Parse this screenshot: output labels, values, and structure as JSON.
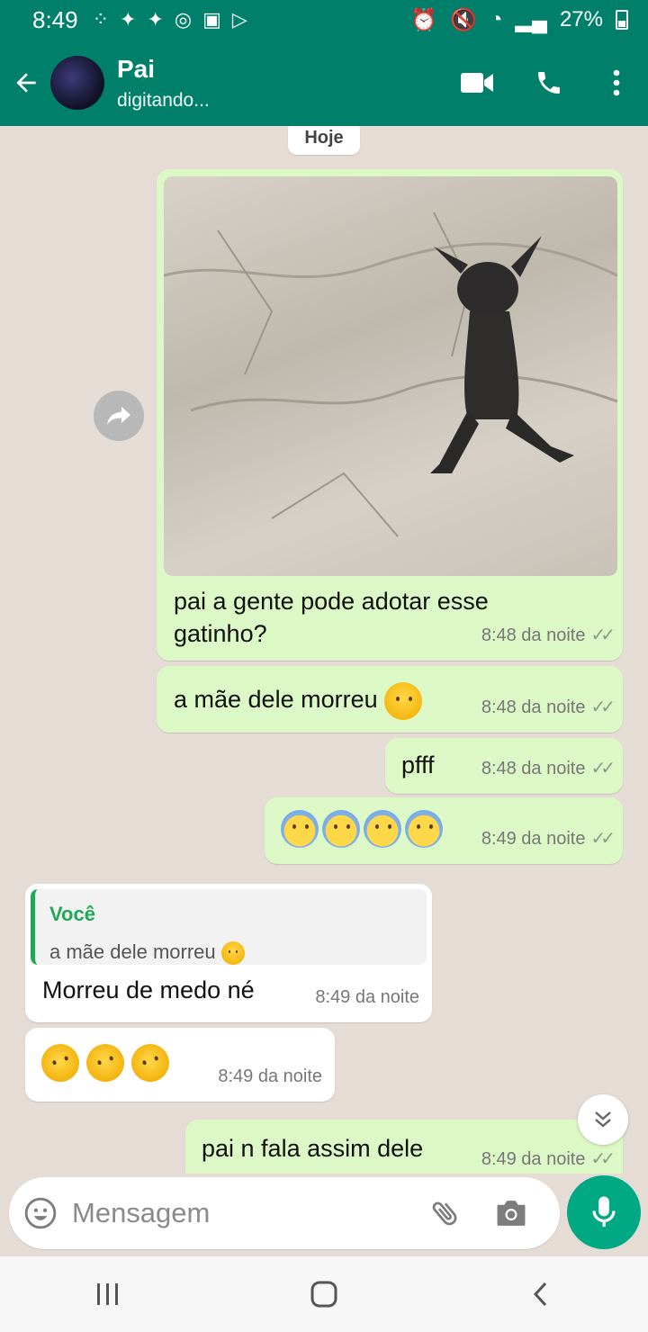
{
  "status_bar": {
    "time": "8:49",
    "battery": "27%"
  },
  "header": {
    "contact_name": "Pai",
    "contact_status": "digitando..."
  },
  "chat": {
    "date_divider": "Hoje",
    "messages": [
      {
        "dir": "out",
        "kind": "image",
        "caption_line1": "pai a gente pode adotar esse",
        "caption_line2": "gatinho?",
        "time": "8:48 da noite"
      },
      {
        "dir": "out",
        "text": "a mãe dele morreu",
        "time": "8:48 da noite"
      },
      {
        "dir": "out",
        "text": "pfff",
        "time": "8:48 da noite"
      },
      {
        "dir": "out",
        "kind": "emoji",
        "time": "8:49 da noite"
      },
      {
        "dir": "in",
        "reply_author": "Você",
        "reply_text": "a mãe dele morreu",
        "text": "Morreu de medo né",
        "time": "8:49 da noite"
      },
      {
        "dir": "in",
        "kind": "emoji",
        "time": "8:49 da noite"
      },
      {
        "dir": "out",
        "text": "pai n fala assim dele",
        "time": "8:49 da noite"
      }
    ]
  },
  "composer": {
    "placeholder": "Mensagem"
  },
  "icons": {
    "back": "arrow-left-icon",
    "video": "video-call-icon",
    "call": "phone-icon",
    "menu": "more-vert-icon",
    "forward": "forward-icon",
    "emoji": "emoji-icon",
    "attach": "paperclip-icon",
    "camera": "camera-icon",
    "mic": "mic-icon",
    "scroll": "chevron-double-down-icon",
    "nav_recents": "recents-icon",
    "nav_home": "home-icon",
    "nav_back": "nav-back-icon"
  },
  "colors": {
    "header": "#00806b",
    "outgoing_bubble": "#dcf8c6",
    "incoming_bubble": "#ffffff",
    "chat_bg": "#e5ddd5",
    "mic_button": "#00a884",
    "quote_accent": "#1fa855"
  }
}
